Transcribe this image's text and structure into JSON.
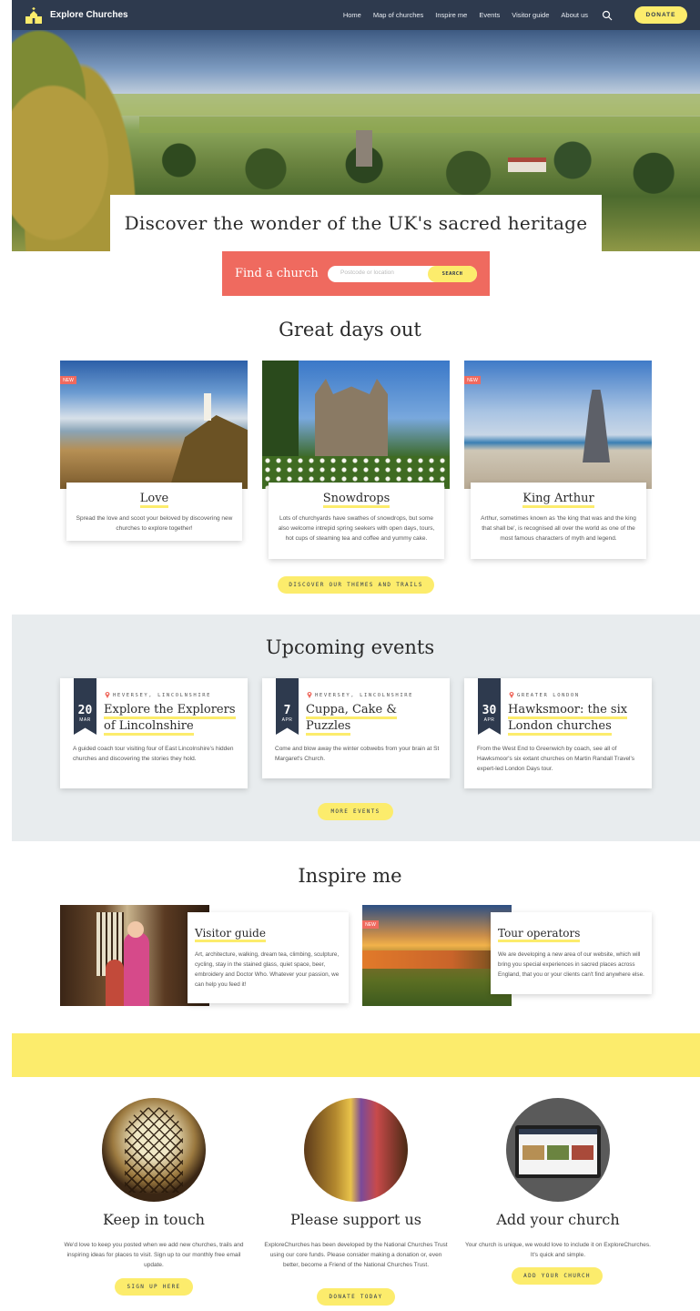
{
  "nav": {
    "brand": "Explore Churches",
    "links": [
      "Home",
      "Map of churches",
      "Inspire me",
      "Events",
      "Visitor guide",
      "About us"
    ],
    "donate": "DONATE"
  },
  "hero": {
    "title": "Discover the wonder of the UK's sacred heritage"
  },
  "find": {
    "label": "Find a church",
    "placeholder": "Postcode or location",
    "button": "SEARCH"
  },
  "great_days": {
    "title": "Great days out",
    "cards": [
      {
        "badge": "NEW",
        "title": "Love",
        "desc": "Spread the love and scoot your beloved by discovering new churches to explore together!"
      },
      {
        "badge": "",
        "title": "Snowdrops",
        "desc": "Lots of churchyards have swathes of snowdrops, but some also welcome intrepid spring seekers with open days, tours, hot cups of steaming tea and coffee and yummy cake."
      },
      {
        "badge": "NEW",
        "title": "King Arthur",
        "desc": "Arthur, sometimes known as 'the king that was and the king that shall be', is recognised all over the world as one of the most famous characters of myth and legend."
      }
    ],
    "button": "DISCOVER OUR THEMES AND TRAILS"
  },
  "events": {
    "title": "Upcoming events",
    "items": [
      {
        "day": "20",
        "month": "MAR",
        "location": "HEVERSEY, LINCOLNSHIRE",
        "title": "Explore the Explorers of Lincolnshire",
        "desc": "A guided coach tour visiting four of East Lincolnshire's hidden churches and discovering the stories they hold."
      },
      {
        "day": "7",
        "month": "APR",
        "location": "HEVERSEY, LINCOLNSHIRE",
        "title": "Cuppa, Cake & Puzzles",
        "desc": "Come and blow away the winter cobwebs from your brain at St Margaret's Church."
      },
      {
        "day": "30",
        "month": "APR",
        "location": "GREATER LONDON",
        "title": "Hawksmoor: the six London churches",
        "desc": "From the West End to Greenwich by coach, see all of Hawksmoor's six extant churches on Martin Randall Travel's expert-led London Days tour."
      }
    ],
    "button": "MORE EVENTS"
  },
  "inspire": {
    "title": "Inspire me",
    "items": [
      {
        "badge": "",
        "title": "Visitor guide",
        "desc": "Art, architecture, walking, dream tea, climbing, sculpture, cycling, stay in the stained glass, quiet space, beer, embroidery and Doctor Who. Whatever your passion, we can help you feed it!"
      },
      {
        "badge": "NEW",
        "title": "Tour operators",
        "desc": "We are developing a new area of our website, which will bring you special experiences in sacred places across England, that you or your clients can't find anywhere else."
      }
    ]
  },
  "footer_cols": [
    {
      "title": "Keep in touch",
      "desc": "We'd love to keep you posted when we add new churches, trails and inspiring ideas for places to visit. Sign up to our monthly free email update.",
      "button": "SIGN UP HERE"
    },
    {
      "title": "Please support us",
      "desc": "ExploreChurches has been developed by the National Churches Trust using our core funds. Please consider making a donation or, even better, become a Friend of the National Churches Trust.",
      "button": "DONATE TODAY"
    },
    {
      "title": "Add your church",
      "desc": "Your church is unique, we would love to include it on ExploreChurches. It's quick and simple.",
      "button": "ADD YOUR CHURCH"
    }
  ],
  "colors": {
    "nav": "#2e3a4e",
    "accent_yellow": "#fcec6c",
    "coral": "#ef6a5f",
    "events_bg": "#e8ecee"
  }
}
